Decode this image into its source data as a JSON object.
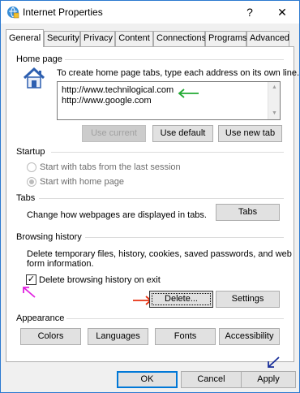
{
  "window": {
    "title": "Internet Properties"
  },
  "titlebar": {
    "help_label": "?",
    "close_label": "✕"
  },
  "tabs": [
    "General",
    "Security",
    "Privacy",
    "Content",
    "Connections",
    "Programs",
    "Advanced"
  ],
  "home_page": {
    "group_label": "Home page",
    "instruction": "To create home page tabs, type each address on its own line.",
    "urls": [
      "http://www.technilogical.com",
      "http://www.google.com"
    ],
    "buttons": {
      "use_current": "Use current",
      "use_default": "Use default",
      "use_new_tab": "Use new tab"
    }
  },
  "startup": {
    "group_label": "Startup",
    "option_last_session": "Start with tabs from the last session",
    "option_home_page": "Start with home page"
  },
  "tabs_group": {
    "group_label": "Tabs",
    "description": "Change how webpages are displayed in tabs.",
    "button": "Tabs"
  },
  "browsing_history": {
    "group_label": "Browsing history",
    "description_line1": "Delete temporary files, history, cookies, saved passwords, and web",
    "description_line2": "form information.",
    "checkbox_label": "Delete browsing history on exit",
    "checkbox_checked": true,
    "delete_button": "Delete...",
    "settings_button": "Settings"
  },
  "appearance": {
    "group_label": "Appearance",
    "buttons": [
      "Colors",
      "Languages",
      "Fonts",
      "Accessibility"
    ]
  },
  "footer": {
    "ok": "OK",
    "cancel": "Cancel",
    "apply": "Apply"
  },
  "annotation_colors": {
    "green": "#22aa33",
    "magenta": "#e020e0",
    "red": "#e83010",
    "blue": "#1a2f9a"
  }
}
